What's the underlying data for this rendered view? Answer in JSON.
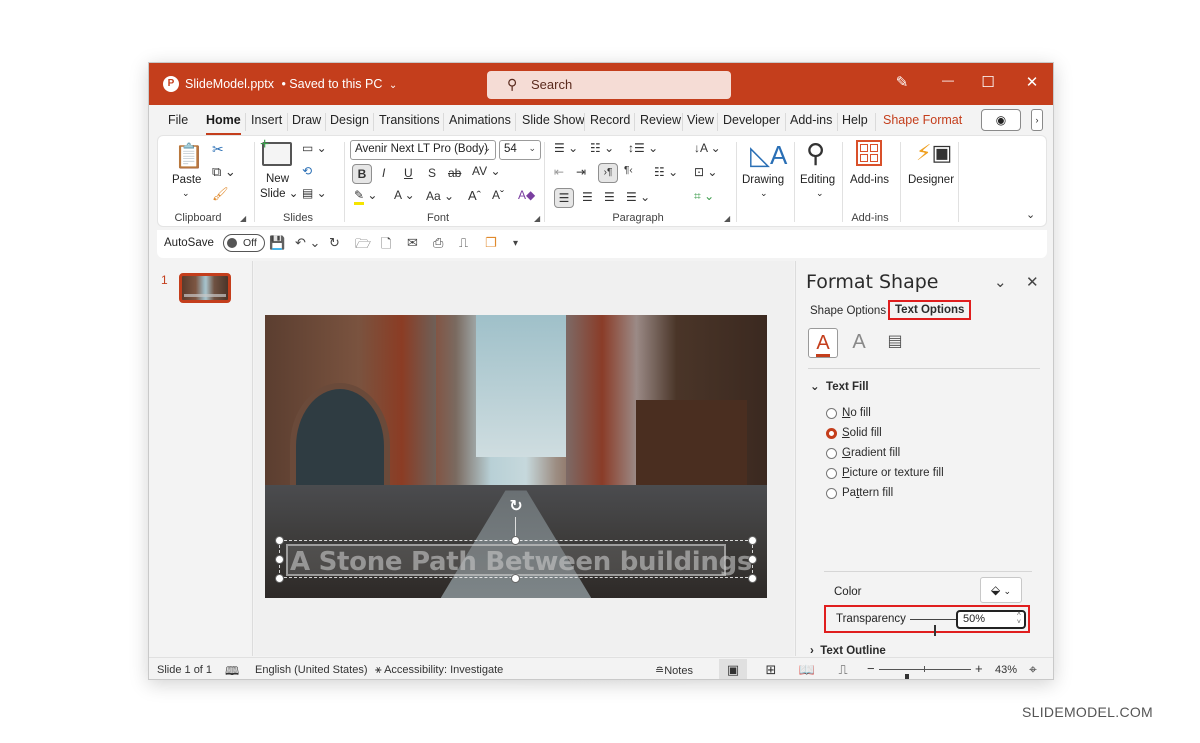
{
  "titlebar": {
    "app_icon": "powerpoint-icon",
    "document_title": "SlideModel.pptx",
    "save_status": "• Saved to this PC",
    "search_placeholder": "Search",
    "controls": {
      "pen": "✎",
      "minimize": "—",
      "maximize": "☐",
      "close": "✕"
    }
  },
  "tabs": [
    "File",
    "Home",
    "Insert",
    "Draw",
    "Design",
    "Transitions",
    "Animations",
    "Slide Show",
    "Record",
    "Review",
    "View",
    "Developer",
    "Add-ins",
    "Help",
    "Shape Format"
  ],
  "active_tab": "Home",
  "ribbon": {
    "clipboard": {
      "paste": "Paste",
      "label": "Clipboard"
    },
    "slides": {
      "new_slide_line1": "New",
      "new_slide_line2": "Slide",
      "label": "Slides"
    },
    "font": {
      "font_name": "Avenir Next LT Pro (Body)",
      "font_size": "54",
      "label": "Font",
      "buttons": [
        "B",
        "I",
        "U",
        "S",
        "ab",
        "AV"
      ]
    },
    "paragraph": {
      "label": "Paragraph"
    },
    "drawing": {
      "label": "Drawing"
    },
    "editing": {
      "label": "Editing"
    },
    "addins": {
      "button": "Add-ins",
      "label": "Add-ins"
    },
    "designer": {
      "label": "Designer"
    }
  },
  "qat": {
    "autosave_label": "AutoSave",
    "autosave_state": "Off"
  },
  "thumbnails": {
    "slide_number": "1"
  },
  "slide": {
    "text": "A Stone Path Between buildings"
  },
  "format_pane": {
    "title": "Format Shape",
    "tabs": [
      "Shape Options",
      "Text Options"
    ],
    "active_tab": "Text Options",
    "text_fill": {
      "heading": "Text Fill",
      "options": [
        "No fill",
        "Solid fill",
        "Gradient fill",
        "Picture or texture fill",
        "Pattern fill"
      ],
      "selected": "Solid fill",
      "color_label": "Color",
      "transparency_label": "Transparency",
      "transparency_value": "50%",
      "transparency_fraction": 0.5
    },
    "text_outline": {
      "heading": "Text Outline"
    }
  },
  "statusbar": {
    "slide_info": "Slide 1 of 1",
    "language": "English (United States)",
    "accessibility": "Accessibility: Investigate",
    "notes": "Notes",
    "zoom_value": "43%",
    "zoom_fraction": 0.43
  },
  "colors": {
    "accent": "#c43e1c",
    "highlight_box": "#e01e1e"
  },
  "watermark": "SLIDEMODEL.COM"
}
